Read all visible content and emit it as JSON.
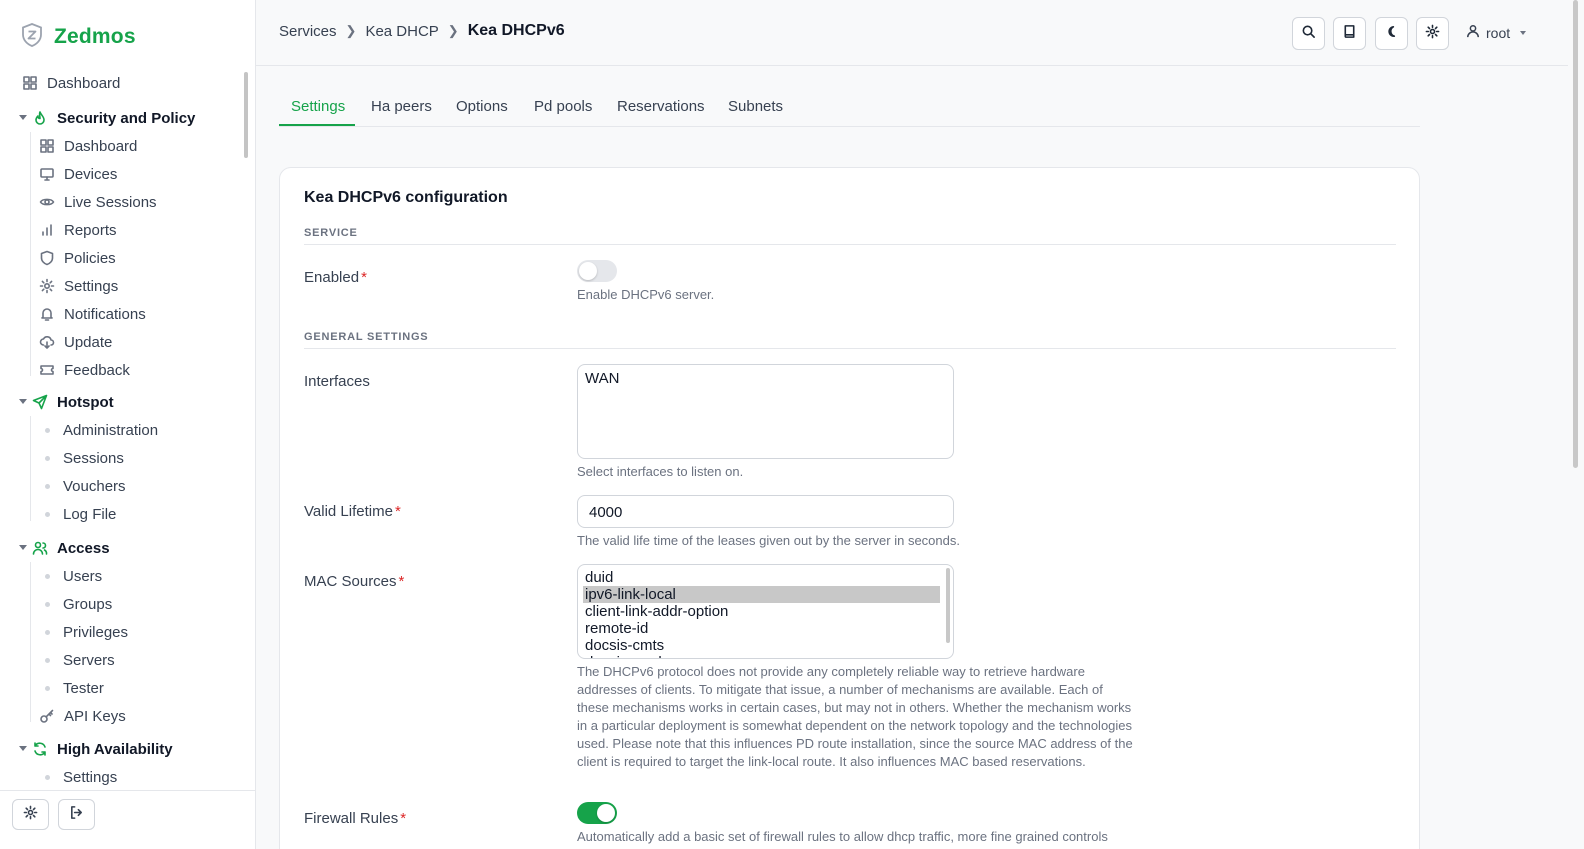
{
  "brand": {
    "name": "Zedmos"
  },
  "sidebar": {
    "dashboard": "Dashboard",
    "sections": [
      {
        "label": "Security and Policy",
        "items": [
          "Dashboard",
          "Devices",
          "Live Sessions",
          "Reports",
          "Policies",
          "Settings",
          "Notifications",
          "Update",
          "Feedback"
        ]
      },
      {
        "label": "Hotspot",
        "items": [
          "Administration",
          "Sessions",
          "Vouchers",
          "Log File"
        ]
      },
      {
        "label": "Access",
        "items": [
          "Users",
          "Groups",
          "Privileges",
          "Servers",
          "Tester",
          "API Keys"
        ]
      },
      {
        "label": "High Availability",
        "items": [
          "Settings"
        ]
      }
    ]
  },
  "header": {
    "breadcrumb": [
      "Services",
      "Kea DHCP",
      "Kea DHCPv6"
    ],
    "user": "root"
  },
  "tabs": [
    "Settings",
    "Ha peers",
    "Options",
    "Pd pools",
    "Reservations",
    "Subnets"
  ],
  "active_tab": "Settings",
  "card": {
    "title": "Kea DHCPv6 configuration",
    "sections": {
      "service": "SERVICE",
      "general": "GENERAL SETTINGS"
    },
    "fields": {
      "enabled": {
        "label": "Enabled",
        "required": "*",
        "value": false,
        "help": "Enable DHCPv6 server."
      },
      "interfaces": {
        "label": "Interfaces",
        "value": "WAN",
        "help": "Select interfaces to listen on."
      },
      "valid_lifetime": {
        "label": "Valid Lifetime",
        "required": "*",
        "value": "4000",
        "help": "The valid life time of the leases given out by the server in seconds."
      },
      "mac_sources": {
        "label": "MAC Sources",
        "required": "*",
        "options": [
          "duid",
          "ipv6-link-local",
          "client-link-addr-option",
          "remote-id",
          "docsis-cmts",
          "docsis-modem"
        ],
        "selected": "ipv6-link-local",
        "help": "The DHCPv6 protocol does not provide any completely reliable way to retrieve hardware addresses of clients. To mitigate that issue, a number of mechanisms are available. Each of these mechanisms works in certain cases, but may not in others. Whether the mechanism works in a particular deployment is somewhat dependent on the network topology and the technologies used. Please note that this influences PD route installation, since the source MAC address of the client is required to target the link-local route. It also influences MAC based reservations."
      },
      "firewall_rules": {
        "label": "Firewall Rules",
        "required": "*",
        "value": true,
        "help": "Automatically add a basic set of firewall rules to allow dhcp traffic, more fine grained controls"
      }
    }
  },
  "colors": {
    "accent": "#16a34a",
    "required": "#dc2626",
    "selected_option": "#c8c8c8"
  }
}
